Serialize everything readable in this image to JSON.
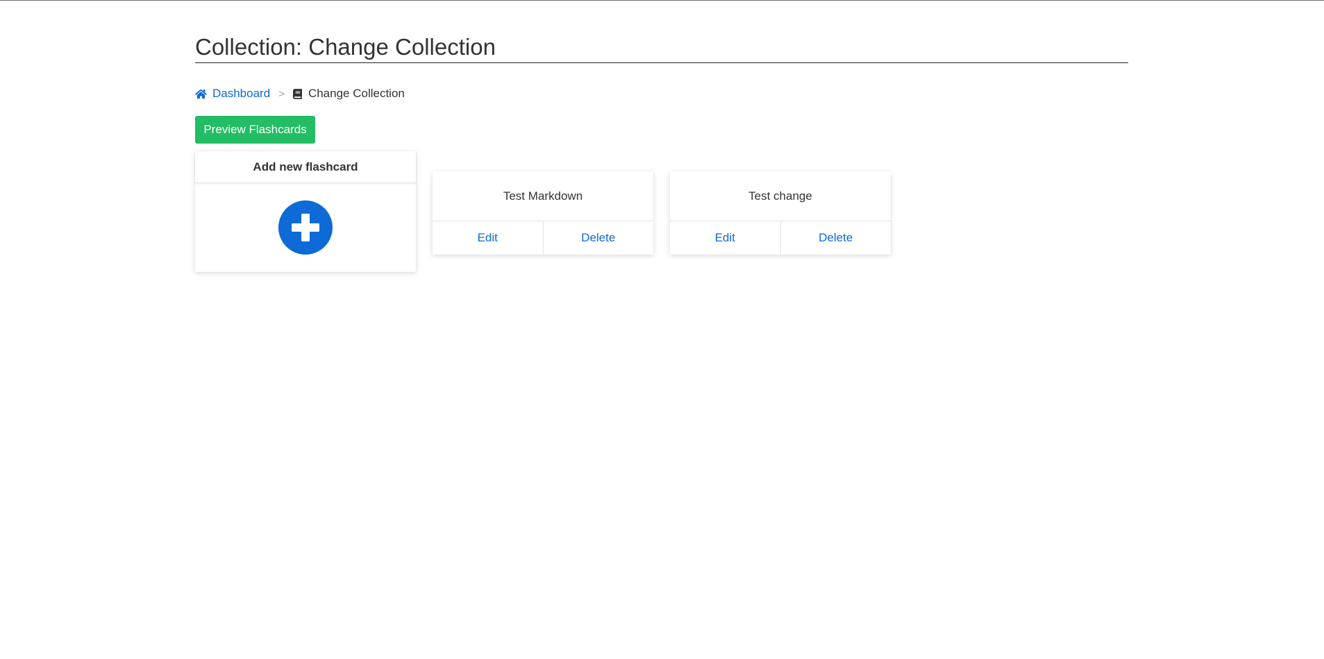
{
  "page": {
    "title": "Collection: Change Collection"
  },
  "breadcrumb": {
    "home_icon": "home-icon",
    "home_label": "Dashboard",
    "separator": ">",
    "current_icon": "book-icon",
    "current_label": "Change Collection"
  },
  "toolbar": {
    "preview_label": "Preview Flashcards"
  },
  "add_card": {
    "header": "Add new flashcard",
    "icon": "plus-circle-icon"
  },
  "flashcards": [
    {
      "title": "Test Markdown",
      "edit_label": "Edit",
      "delete_label": "Delete"
    },
    {
      "title": "Test change",
      "edit_label": "Edit",
      "delete_label": "Delete"
    }
  ],
  "colors": {
    "link": "#0d6ad6",
    "success": "#22bd64",
    "text": "#333333"
  }
}
